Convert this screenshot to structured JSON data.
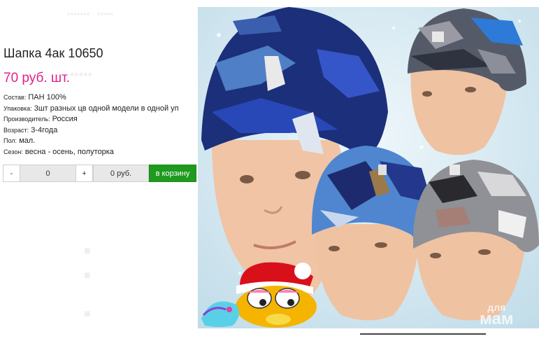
{
  "product": {
    "title": "Шапка 4ак 10650",
    "price": "70 руб. шт."
  },
  "properties": [
    {
      "key": "Состав:",
      "value": "ПАН 100%"
    },
    {
      "key": "Упаковка:",
      "value": "3шт разных цв одной модели в одной уп"
    },
    {
      "key": "Производитель:",
      "value": "Россия"
    },
    {
      "key": "Возраст:",
      "value": "3-4года"
    },
    {
      "key": "Пол:",
      "value": "мал."
    },
    {
      "key": "Сезон:",
      "value": "весна - осень, полуторка"
    }
  ],
  "buy": {
    "minus": "-",
    "quantity": "0",
    "plus": "+",
    "sum": "0 руб.",
    "cart_label": "в корзину"
  },
  "watermark": {
    "line1": "для",
    "line2": "мам"
  },
  "colors": {
    "price": "#e0218a",
    "cart": "#1e9a1e",
    "photo_bg": "#d8ecf3"
  }
}
